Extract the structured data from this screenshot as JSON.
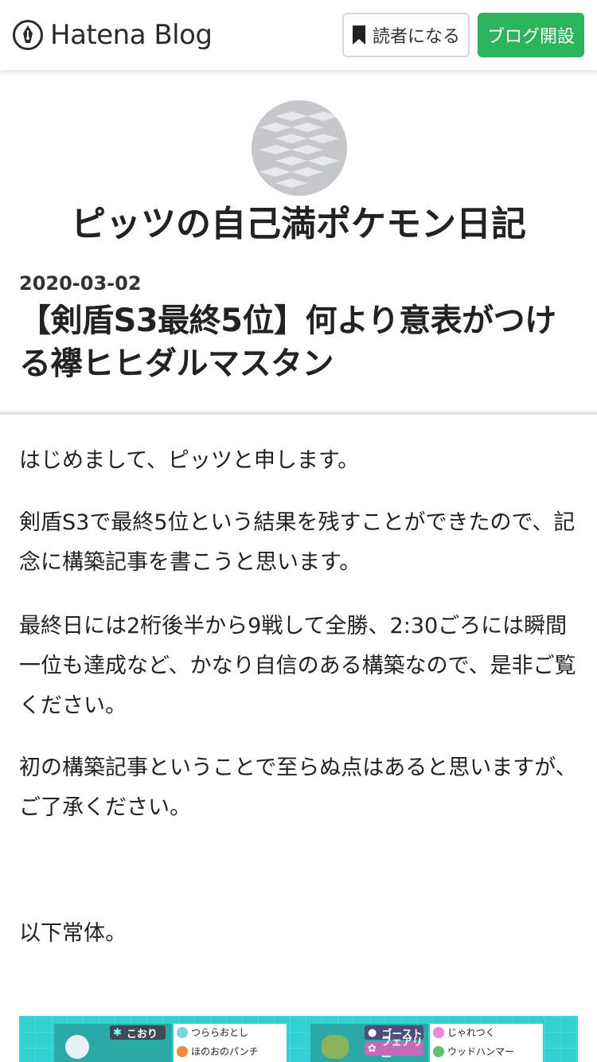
{
  "header": {
    "logo_text": "Hatena Blog",
    "reader_button_label": "読者になる",
    "open_blog_button_label": "ブログ開設",
    "accent_color": "#2bb45b"
  },
  "blog": {
    "title": "ピッツの自己満ポケモン日記"
  },
  "entry": {
    "date": "2020-03-02",
    "title": "【剣盾S3最終5位】何より意表がつける襷ヒヒダルマスタン",
    "paragraphs": [
      "はじめまして、ピッツと申します。",
      "剣盾S3で最終5位という結果を残すことができたので、記念に構築記事を書こうと思います。",
      "最終日には2桁後半から9戦して全勝、2:30ごろには瞬間一位も達成など、かなり自信のある構築なので、是非ご覧ください。",
      "初の構築記事ということで至らぬ点はあると思いますが、ご了承ください。",
      "以下常体。"
    ]
  },
  "party_image": {
    "left_card": {
      "type_label": "こおり",
      "moves": [
        "つららおとし",
        "ほのおのパンチ"
      ]
    },
    "right_card": {
      "type_labels": [
        "ゴースト",
        "フェアリー"
      ],
      "moves": [
        "じゃれつく",
        "ウッドハンマー"
      ]
    }
  }
}
